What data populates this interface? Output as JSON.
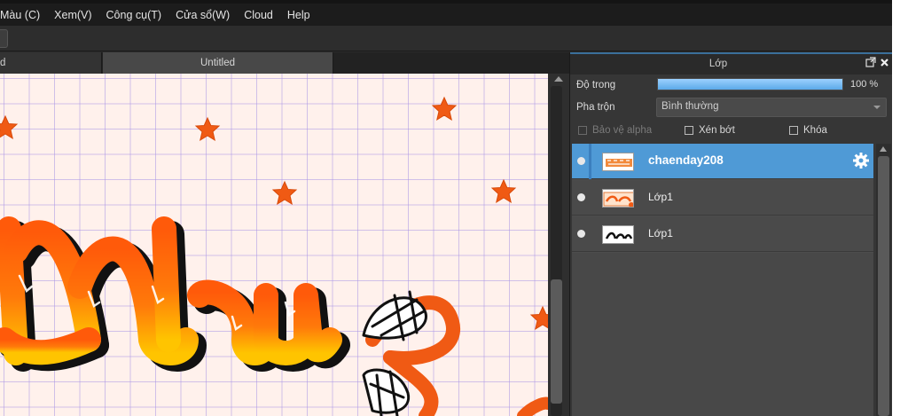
{
  "menu": [
    "Màu (C)",
    "Xem(V)",
    "Công cụ(T)",
    "Cửa sổ(W)",
    "Cloud",
    "Help"
  ],
  "doc_tabs": [
    {
      "label": "d"
    },
    {
      "label": "Untitled"
    }
  ],
  "layer_panel": {
    "title": "Lớp",
    "opacity_label": "Độ trong",
    "opacity_value": "100 %",
    "opacity_fraction": 1.0,
    "blend_label": "Pha trộn",
    "blend_value": "Bình thường",
    "protect_alpha_label": "Bảo vệ alpha",
    "clipping_label": "Xén bớt",
    "lock_label": "Khóa",
    "layers": [
      {
        "name": "chaenday208",
        "active": true
      },
      {
        "name": "Lớp1",
        "active": false
      },
      {
        "name": "Lớp1",
        "active": false
      }
    ]
  },
  "colors": {
    "accent": "#4f9ad6",
    "canvas_paper": "#fff1ec",
    "grid": "#aa96e6",
    "star": "#f05a14",
    "lettering_top": "#ff5a0a",
    "lettering_bottom": "#ffc000"
  },
  "icons": [
    "detach-icon",
    "close-icon",
    "gear-icon",
    "visibility-dot-icon"
  ]
}
